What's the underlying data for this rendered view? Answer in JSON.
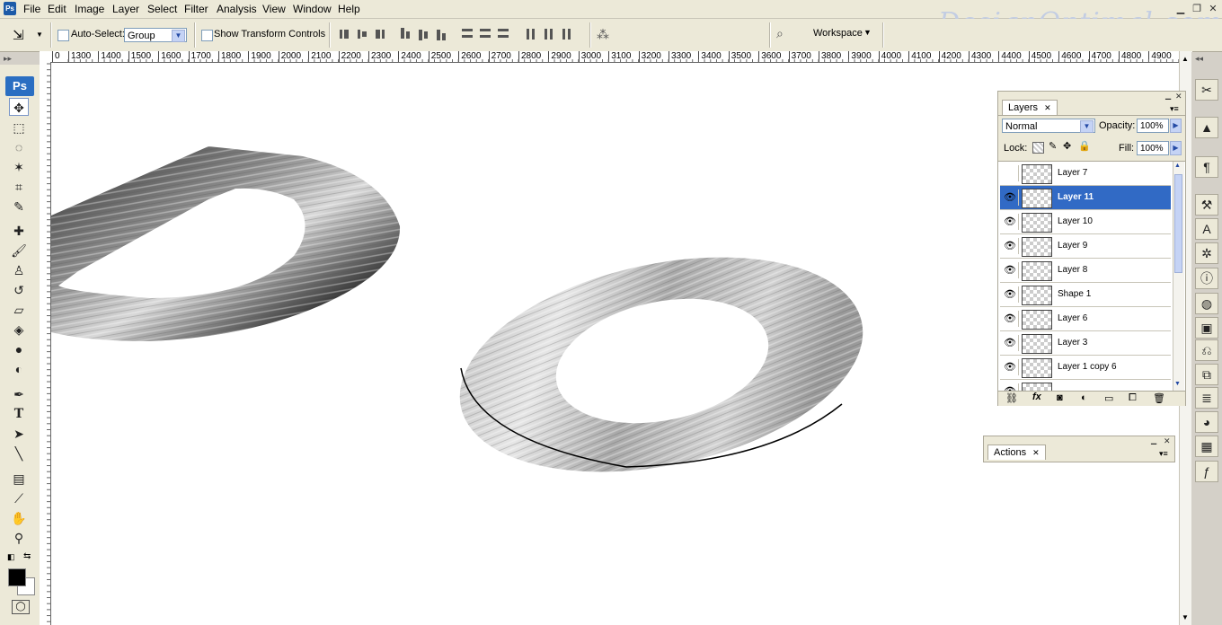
{
  "app": {
    "logo_text": "Ps",
    "watermark": "DesignOptimal.com"
  },
  "menu": [
    "File",
    "Edit",
    "Image",
    "Layer",
    "Select",
    "Filter",
    "Analysis",
    "View",
    "Window",
    "Help"
  ],
  "options_bar": {
    "auto_select_label": "Auto-Select:",
    "auto_select_value": "Group",
    "show_transform_label": "Show Transform Controls",
    "workspace_label": "Workspace"
  },
  "ruler": {
    "h_labels": [
      "0",
      "1300",
      "1400",
      "1500",
      "1600",
      "1700",
      "1800",
      "1900",
      "2000",
      "2100",
      "2200",
      "2300",
      "2400",
      "2500",
      "2600",
      "2700",
      "2800",
      "2900",
      "3000",
      "3100",
      "3200",
      "3300",
      "3400",
      "3500",
      "3600",
      "3700",
      "3800",
      "3900",
      "4000",
      "4100",
      "4200",
      "4300",
      "4400",
      "4500",
      "4600",
      "4700",
      "4800",
      "4900"
    ]
  },
  "layers_panel": {
    "title": "Layers",
    "blend_mode": "Normal",
    "opacity_label": "Opacity:",
    "opacity_value": "100%",
    "lock_label": "Lock:",
    "fill_label": "Fill:",
    "fill_value": "100%",
    "layers": [
      {
        "name": "Layer 7",
        "visible": false,
        "selected": false
      },
      {
        "name": "Layer 11",
        "visible": true,
        "selected": true
      },
      {
        "name": "Layer 10",
        "visible": true,
        "selected": false
      },
      {
        "name": "Layer 9",
        "visible": true,
        "selected": false
      },
      {
        "name": "Layer 8",
        "visible": true,
        "selected": false
      },
      {
        "name": "Shape 1",
        "visible": true,
        "selected": false
      },
      {
        "name": "Layer 6",
        "visible": true,
        "selected": false
      },
      {
        "name": "Layer 3",
        "visible": true,
        "selected": false
      },
      {
        "name": "Layer 1 copy 6",
        "visible": true,
        "selected": false
      }
    ]
  },
  "actions_panel": {
    "title": "Actions"
  },
  "colors": {
    "selection": "#316ac5",
    "ps_blue": "#2a6ec2"
  }
}
